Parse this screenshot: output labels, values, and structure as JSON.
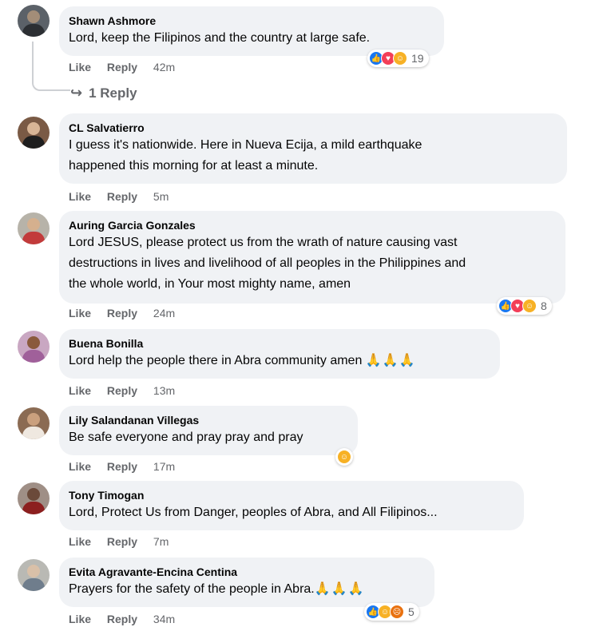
{
  "actions": {
    "like": "Like",
    "reply": "Reply"
  },
  "view_replies": "1 Reply",
  "comments": [
    {
      "name": "Shawn Ashmore",
      "lines": [
        "Lord, keep the Filipinos and the country at large safe."
      ],
      "time": "42m",
      "reaction_count": "19",
      "reactions": [
        "like",
        "love",
        "care"
      ]
    },
    {
      "name": "CL Salvatierro",
      "lines": [
        "I guess it's nationwide. Here in Nueva Ecija, a mild earthquake",
        "happened this morning for at least a minute."
      ],
      "time": "5m"
    },
    {
      "name": "Auring Garcia Gonzales",
      "lines": [
        "Lord JESUS, please protect us from the wrath of nature causing vast",
        "destructions in lives and livelihood of all peoples in the Philippines and",
        "the whole world, in Your most mighty name, amen"
      ],
      "time": "24m",
      "reaction_count": "8",
      "reactions": [
        "like",
        "love",
        "care"
      ]
    },
    {
      "name": "Buena Bonilla",
      "lines": [
        "Lord help the people there in Abra community amen"
      ],
      "emoji": "🙏🙏🙏",
      "time": "13m"
    },
    {
      "name": "Lily Salandanan Villegas",
      "lines": [
        "Be safe everyone and pray pray and pray"
      ],
      "time": "17m",
      "reactions": [
        "care"
      ]
    },
    {
      "name": "Tony Timogan",
      "lines": [
        "Lord, Protect Us from Danger, peoples of Abra, and All Filipinos..."
      ],
      "time": "7m"
    },
    {
      "name": "Evita Agravante-Encina Centina",
      "lines": [
        "Prayers for the safety of the people in Abra."
      ],
      "emoji": "🙏🙏🙏",
      "time": "34m",
      "reaction_count": "5",
      "reactions": [
        "like",
        "care",
        "angry"
      ]
    }
  ],
  "colors": {
    "bubble": "#f0f2f5",
    "meta": "#65676b",
    "like": "#1877f2",
    "love": "#f33e58",
    "care": "#f7b125",
    "angry": "#e9710f"
  }
}
